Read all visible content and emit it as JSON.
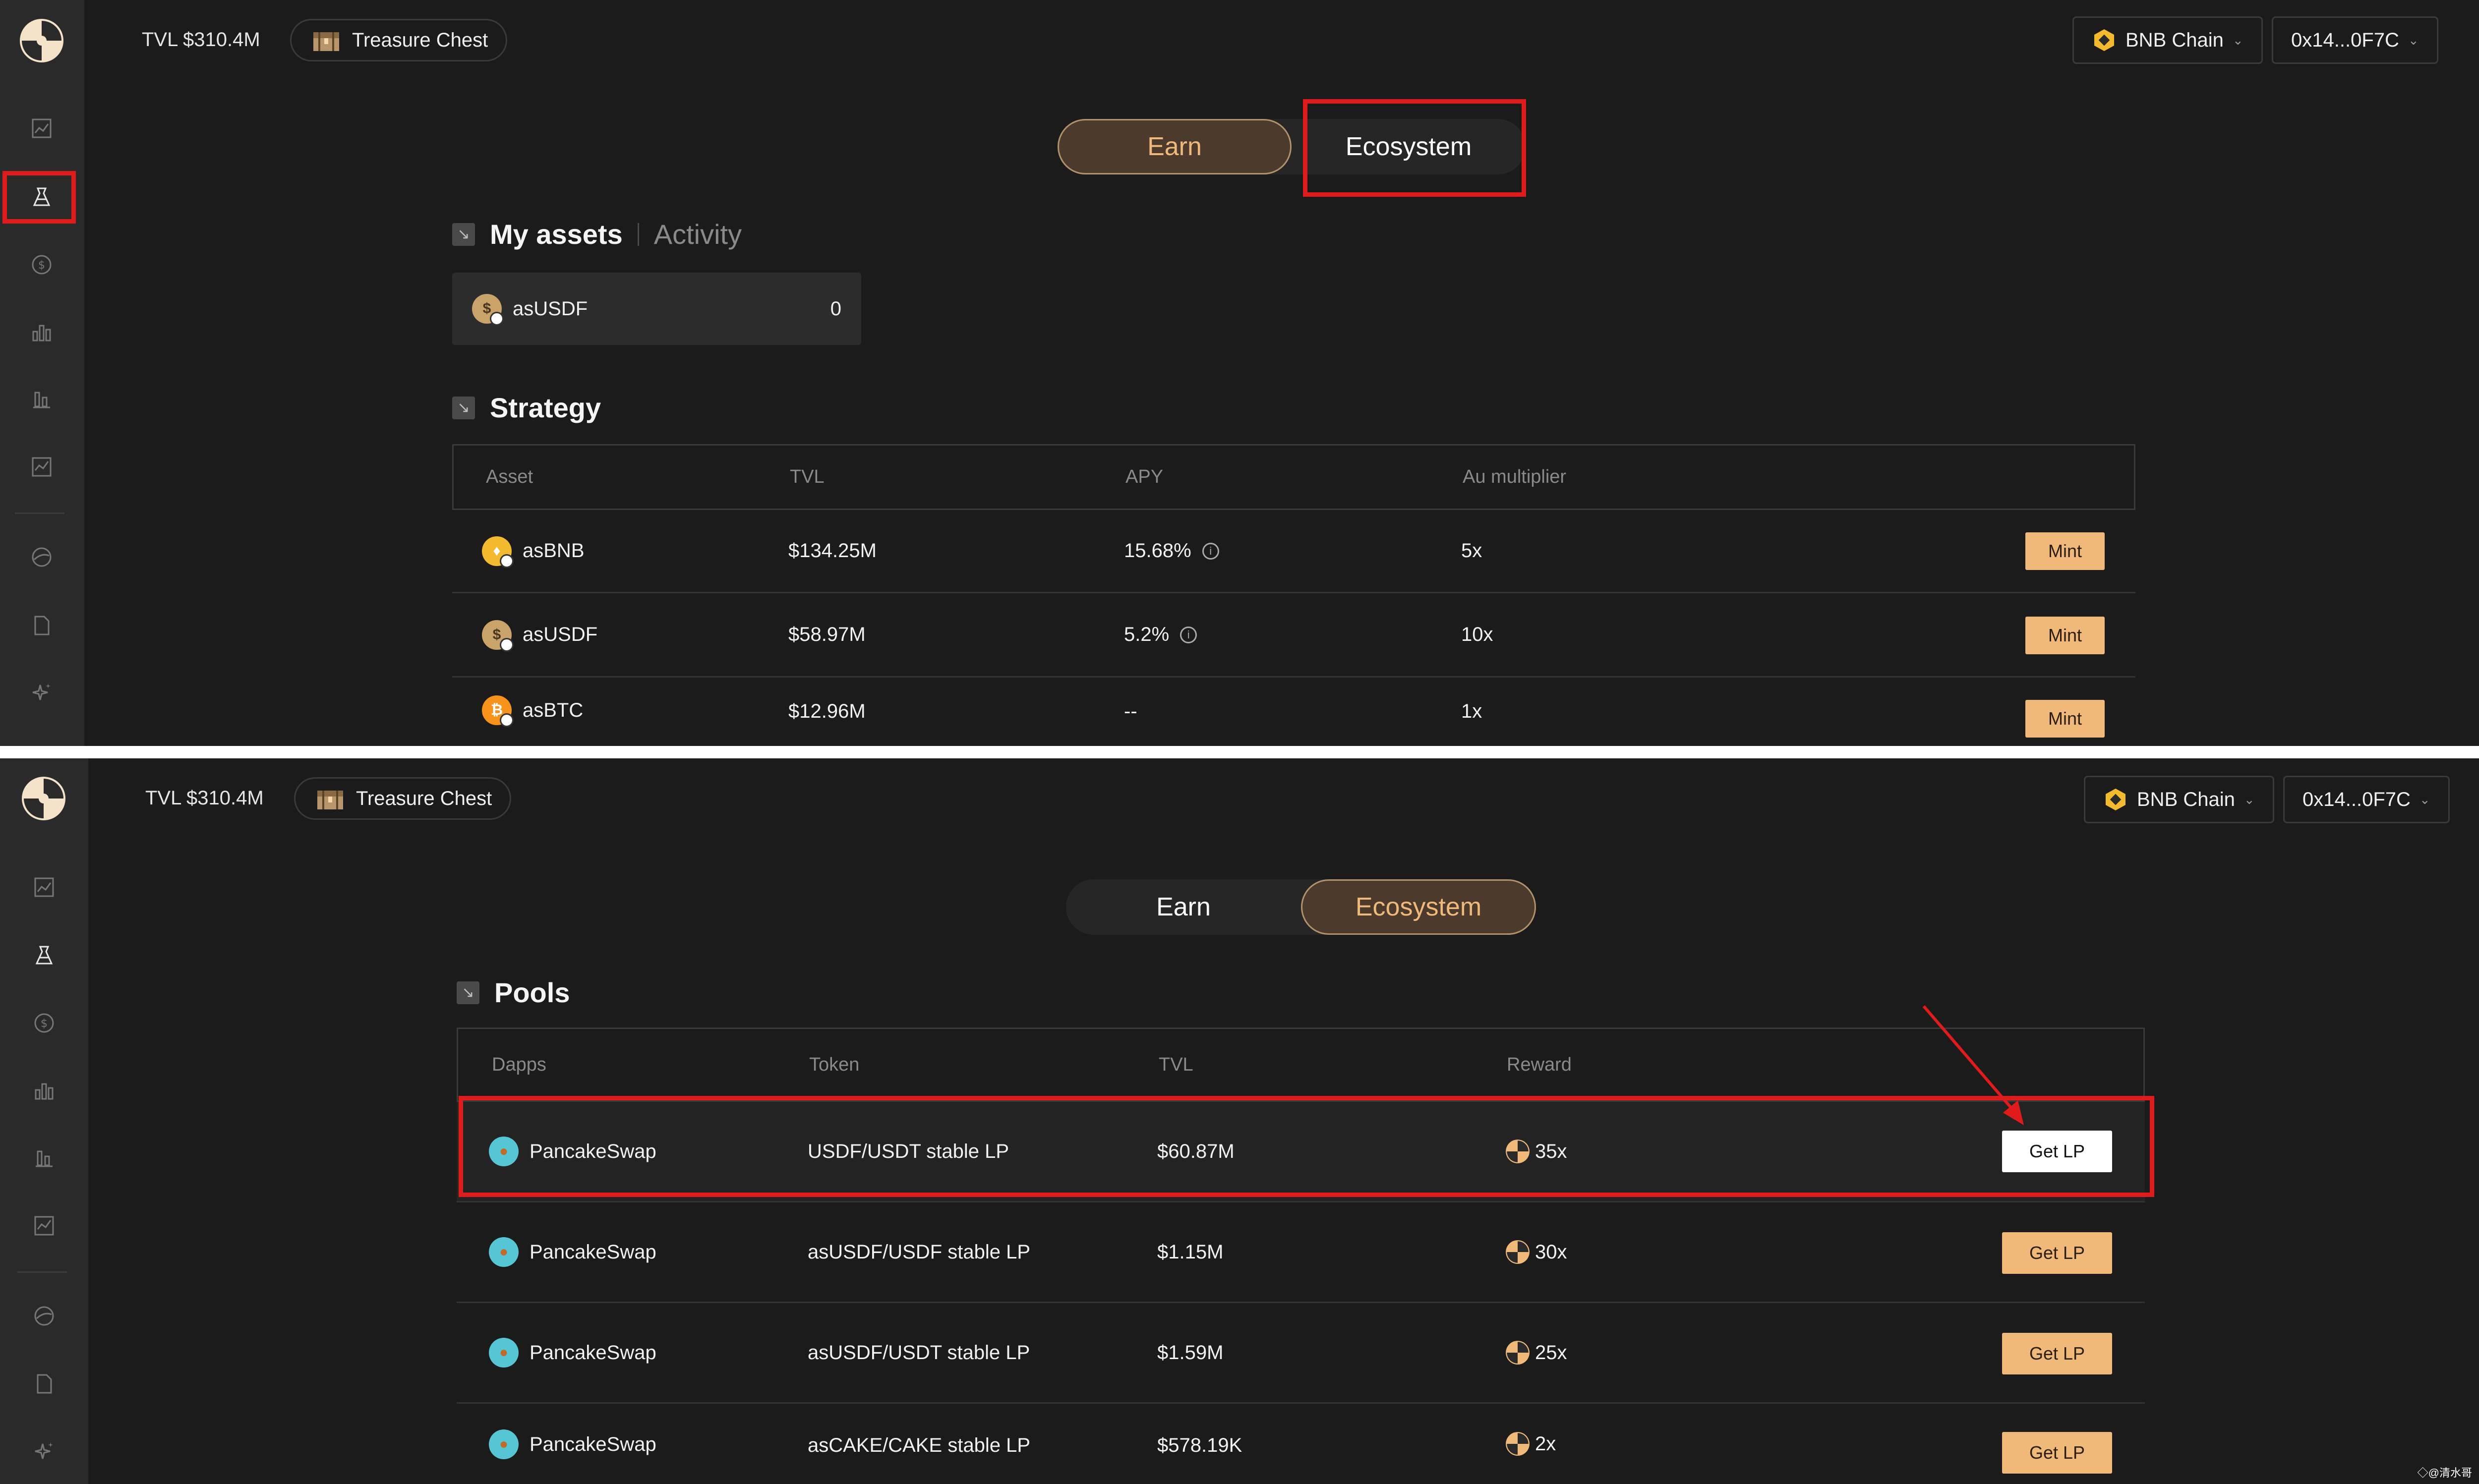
{
  "colors": {
    "accent": "#f0b97a",
    "highlight": "#e01b1b",
    "background": "#1b1b1b",
    "sidebar": "#2a2a2a"
  },
  "top": {
    "header": {
      "tvl": "TVL $310.4M",
      "treasure": "Treasure Chest",
      "chain": "BNB Chain",
      "wallet": "0x14...0F7C"
    },
    "tabs": {
      "earn": "Earn",
      "ecosystem": "Ecosystem",
      "active": "Earn"
    },
    "assets_section": {
      "title": "My assets",
      "alt": "Activity"
    },
    "asset_card": {
      "name": "asUSDF",
      "value": "0"
    },
    "strategy": {
      "title": "Strategy",
      "columns": [
        "Asset",
        "TVL",
        "APY",
        "Au multiplier"
      ],
      "rows": [
        {
          "asset": "asBNB",
          "tvl": "$134.25M",
          "apy": "15.68%",
          "mult": "5x",
          "action": "Mint",
          "icon": "bnb"
        },
        {
          "asset": "asUSDF",
          "tvl": "$58.97M",
          "apy": "5.2%",
          "mult": "10x",
          "action": "Mint",
          "icon": "usd"
        },
        {
          "asset": "asBTC",
          "tvl": "$12.96M",
          "apy": "--",
          "mult": "1x",
          "action": "Mint",
          "icon": "btc"
        }
      ]
    }
  },
  "bottom": {
    "header": {
      "tvl": "TVL $310.4M",
      "treasure": "Treasure Chest",
      "chain": "BNB Chain",
      "wallet": "0x14...0F7C"
    },
    "tabs": {
      "earn": "Earn",
      "ecosystem": "Ecosystem",
      "active": "Ecosystem"
    },
    "pools": {
      "title": "Pools",
      "columns": [
        "Dapps",
        "Token",
        "TVL",
        "Reward"
      ],
      "rows": [
        {
          "dapp": "PancakeSwap",
          "token": "USDF/USDT stable LP",
          "tvl": "$60.87M",
          "reward": "35x",
          "action": "Get LP"
        },
        {
          "dapp": "PancakeSwap",
          "token": "asUSDF/USDF stable LP",
          "tvl": "$1.15M",
          "reward": "30x",
          "action": "Get LP"
        },
        {
          "dapp": "PancakeSwap",
          "token": "asUSDF/USDT stable LP",
          "tvl": "$1.59M",
          "reward": "25x",
          "action": "Get LP"
        },
        {
          "dapp": "PancakeSwap",
          "token": "asCAKE/CAKE stable LP",
          "tvl": "$578.19K",
          "reward": "2x",
          "action": "Get LP"
        }
      ]
    }
  },
  "sidebar_icons": [
    "dashboard-icon",
    "earn-icon",
    "dollar-icon",
    "stats-icon",
    "bar-chart-icon",
    "line-chart-icon",
    "globe-icon",
    "document-icon",
    "sparkle-icon"
  ],
  "watermark": "◇@清水哥"
}
